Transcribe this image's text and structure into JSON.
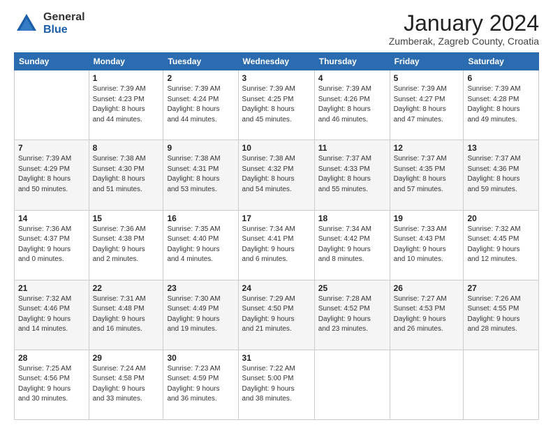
{
  "logo": {
    "general": "General",
    "blue": "Blue"
  },
  "header": {
    "month": "January 2024",
    "location": "Zumberak, Zagreb County, Croatia"
  },
  "days_of_week": [
    "Sunday",
    "Monday",
    "Tuesday",
    "Wednesday",
    "Thursday",
    "Friday",
    "Saturday"
  ],
  "weeks": [
    [
      {
        "day": "",
        "info": ""
      },
      {
        "day": "1",
        "info": "Sunrise: 7:39 AM\nSunset: 4:23 PM\nDaylight: 8 hours\nand 44 minutes."
      },
      {
        "day": "2",
        "info": "Sunrise: 7:39 AM\nSunset: 4:24 PM\nDaylight: 8 hours\nand 44 minutes."
      },
      {
        "day": "3",
        "info": "Sunrise: 7:39 AM\nSunset: 4:25 PM\nDaylight: 8 hours\nand 45 minutes."
      },
      {
        "day": "4",
        "info": "Sunrise: 7:39 AM\nSunset: 4:26 PM\nDaylight: 8 hours\nand 46 minutes."
      },
      {
        "day": "5",
        "info": "Sunrise: 7:39 AM\nSunset: 4:27 PM\nDaylight: 8 hours\nand 47 minutes."
      },
      {
        "day": "6",
        "info": "Sunrise: 7:39 AM\nSunset: 4:28 PM\nDaylight: 8 hours\nand 49 minutes."
      }
    ],
    [
      {
        "day": "7",
        "info": "Sunrise: 7:39 AM\nSunset: 4:29 PM\nDaylight: 8 hours\nand 50 minutes."
      },
      {
        "day": "8",
        "info": "Sunrise: 7:38 AM\nSunset: 4:30 PM\nDaylight: 8 hours\nand 51 minutes."
      },
      {
        "day": "9",
        "info": "Sunrise: 7:38 AM\nSunset: 4:31 PM\nDaylight: 8 hours\nand 53 minutes."
      },
      {
        "day": "10",
        "info": "Sunrise: 7:38 AM\nSunset: 4:32 PM\nDaylight: 8 hours\nand 54 minutes."
      },
      {
        "day": "11",
        "info": "Sunrise: 7:37 AM\nSunset: 4:33 PM\nDaylight: 8 hours\nand 55 minutes."
      },
      {
        "day": "12",
        "info": "Sunrise: 7:37 AM\nSunset: 4:35 PM\nDaylight: 8 hours\nand 57 minutes."
      },
      {
        "day": "13",
        "info": "Sunrise: 7:37 AM\nSunset: 4:36 PM\nDaylight: 8 hours\nand 59 minutes."
      }
    ],
    [
      {
        "day": "14",
        "info": "Sunrise: 7:36 AM\nSunset: 4:37 PM\nDaylight: 9 hours\nand 0 minutes."
      },
      {
        "day": "15",
        "info": "Sunrise: 7:36 AM\nSunset: 4:38 PM\nDaylight: 9 hours\nand 2 minutes."
      },
      {
        "day": "16",
        "info": "Sunrise: 7:35 AM\nSunset: 4:40 PM\nDaylight: 9 hours\nand 4 minutes."
      },
      {
        "day": "17",
        "info": "Sunrise: 7:34 AM\nSunset: 4:41 PM\nDaylight: 9 hours\nand 6 minutes."
      },
      {
        "day": "18",
        "info": "Sunrise: 7:34 AM\nSunset: 4:42 PM\nDaylight: 9 hours\nand 8 minutes."
      },
      {
        "day": "19",
        "info": "Sunrise: 7:33 AM\nSunset: 4:43 PM\nDaylight: 9 hours\nand 10 minutes."
      },
      {
        "day": "20",
        "info": "Sunrise: 7:32 AM\nSunset: 4:45 PM\nDaylight: 9 hours\nand 12 minutes."
      }
    ],
    [
      {
        "day": "21",
        "info": "Sunrise: 7:32 AM\nSunset: 4:46 PM\nDaylight: 9 hours\nand 14 minutes."
      },
      {
        "day": "22",
        "info": "Sunrise: 7:31 AM\nSunset: 4:48 PM\nDaylight: 9 hours\nand 16 minutes."
      },
      {
        "day": "23",
        "info": "Sunrise: 7:30 AM\nSunset: 4:49 PM\nDaylight: 9 hours\nand 19 minutes."
      },
      {
        "day": "24",
        "info": "Sunrise: 7:29 AM\nSunset: 4:50 PM\nDaylight: 9 hours\nand 21 minutes."
      },
      {
        "day": "25",
        "info": "Sunrise: 7:28 AM\nSunset: 4:52 PM\nDaylight: 9 hours\nand 23 minutes."
      },
      {
        "day": "26",
        "info": "Sunrise: 7:27 AM\nSunset: 4:53 PM\nDaylight: 9 hours\nand 26 minutes."
      },
      {
        "day": "27",
        "info": "Sunrise: 7:26 AM\nSunset: 4:55 PM\nDaylight: 9 hours\nand 28 minutes."
      }
    ],
    [
      {
        "day": "28",
        "info": "Sunrise: 7:25 AM\nSunset: 4:56 PM\nDaylight: 9 hours\nand 30 minutes."
      },
      {
        "day": "29",
        "info": "Sunrise: 7:24 AM\nSunset: 4:58 PM\nDaylight: 9 hours\nand 33 minutes."
      },
      {
        "day": "30",
        "info": "Sunrise: 7:23 AM\nSunset: 4:59 PM\nDaylight: 9 hours\nand 36 minutes."
      },
      {
        "day": "31",
        "info": "Sunrise: 7:22 AM\nSunset: 5:00 PM\nDaylight: 9 hours\nand 38 minutes."
      },
      {
        "day": "",
        "info": ""
      },
      {
        "day": "",
        "info": ""
      },
      {
        "day": "",
        "info": ""
      }
    ]
  ]
}
